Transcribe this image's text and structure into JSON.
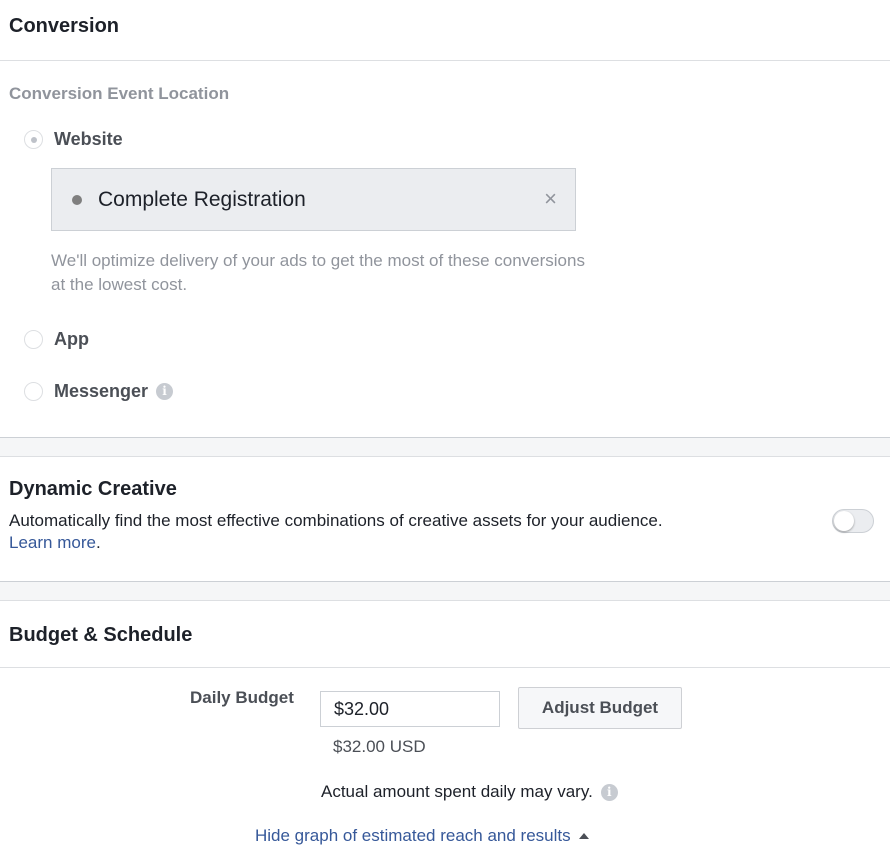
{
  "conversion": {
    "title": "Conversion",
    "event_location_label": "Conversion Event Location",
    "options": [
      {
        "label": "Website",
        "checked": true
      },
      {
        "label": "App",
        "checked": false
      },
      {
        "label": "Messenger",
        "checked": false
      }
    ],
    "selected_event": "Complete Registration",
    "remove_symbol": "×",
    "optimize_note": "We'll optimize delivery of your ads to get the most of these conversions at the lowest cost."
  },
  "dynamic_creative": {
    "title": "Dynamic Creative",
    "description": "Automatically find the most effective combinations of creative assets for your audience.",
    "learn_more": "Learn more",
    "learn_more_suffix": ".",
    "enabled": false
  },
  "budget": {
    "title": "Budget & Schedule",
    "daily_budget_label": "Daily Budget",
    "daily_budget_value": "$32.00",
    "adjust_button": "Adjust Budget",
    "usd_note": "$32.00 USD",
    "vary_note": "Actual amount spent daily may vary.",
    "hide_graph_link": "Hide graph of estimated reach and results"
  },
  "icons": {
    "info": "i",
    "radio": "radio-icon",
    "toggle": "toggle-switch"
  },
  "colors": {
    "link": "#365899",
    "muted_text": "#90949c",
    "divider": "#dddfe2",
    "selected_box": "#ebedf0"
  }
}
